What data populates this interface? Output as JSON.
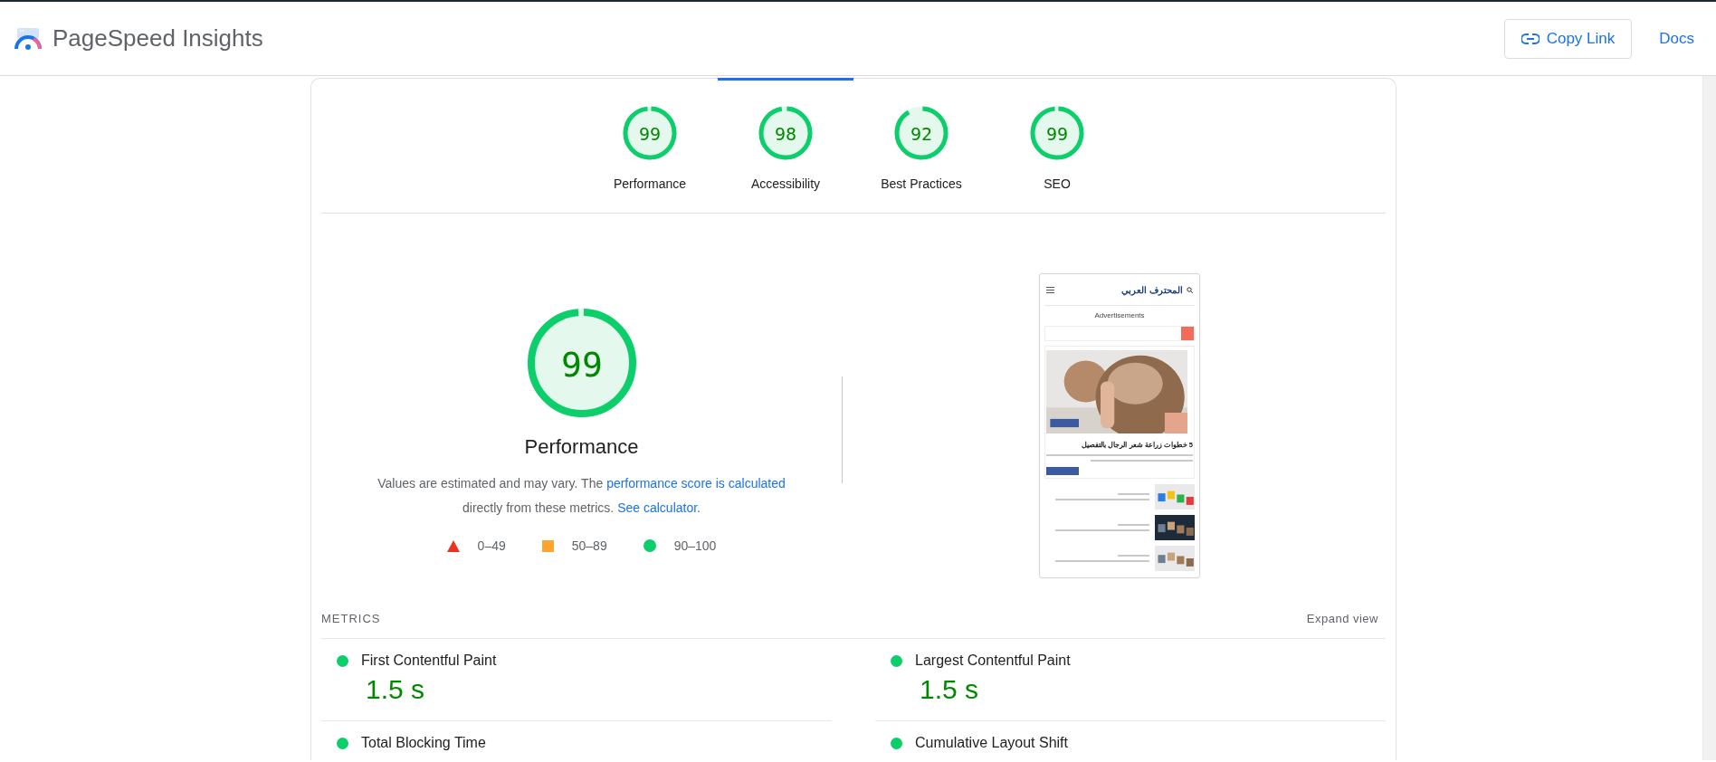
{
  "header": {
    "title": "PageSpeed Insights",
    "copy_link": "Copy Link",
    "docs": "Docs"
  },
  "categories": [
    {
      "label": "Performance",
      "score": "99",
      "level": 0.99,
      "selected": false
    },
    {
      "label": "Accessibility",
      "score": "98",
      "level": 0.98,
      "selected": true
    },
    {
      "label": "Best Practices",
      "score": "92",
      "level": 0.92,
      "selected": false
    },
    {
      "label": "SEO",
      "score": "99",
      "level": 0.99,
      "selected": false
    }
  ],
  "performance": {
    "score": "99",
    "level": 0.99,
    "title": "Performance",
    "description": {
      "before": "Values are estimated and may vary. The ",
      "link1": "performance score is calculated",
      "middle": " directly from these metrics. ",
      "link2": "See calculator."
    },
    "legend": [
      {
        "kind": "fail",
        "label": "0–49"
      },
      {
        "kind": "average",
        "label": "50–89"
      },
      {
        "kind": "pass",
        "label": "90–100"
      }
    ]
  },
  "screenshot": {
    "site_title": "المحترف العربي",
    "ad_label": "Advertisements",
    "headline": "5 خطوات زراعة شعر الرجال بالتفصيل"
  },
  "metrics": {
    "heading": "METRICS",
    "expand": "Expand view",
    "items": [
      {
        "name": "First Contentful Paint",
        "value": "1.5 s",
        "color": "#0cce6b"
      },
      {
        "name": "Largest Contentful Paint",
        "value": "1.5 s",
        "color": "#0cce6b"
      },
      {
        "name": "Total Blocking Time",
        "color": "#0cce6b"
      },
      {
        "name": "Cumulative Layout Shift",
        "color": "#0cce6b"
      }
    ]
  }
}
